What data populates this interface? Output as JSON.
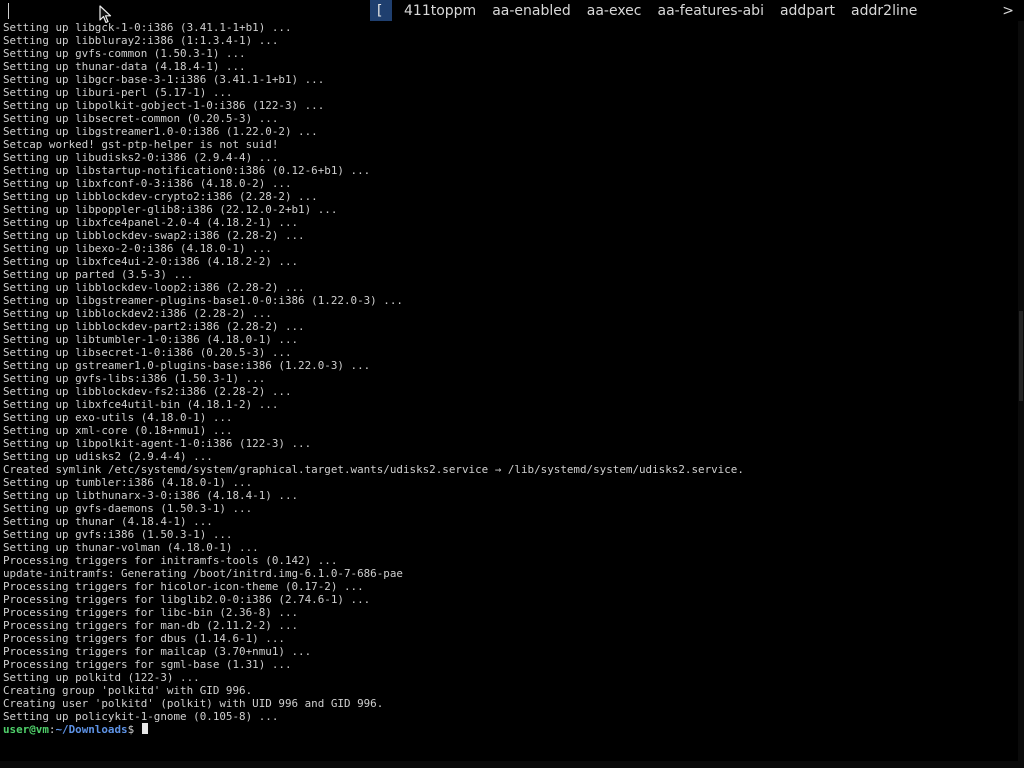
{
  "dmenu": {
    "prompt": "[",
    "items": [
      "411toppm",
      "aa-enabled",
      "aa-exec",
      "aa-features-abi",
      "addpart",
      "addr2line"
    ],
    "more_glyph": ">"
  },
  "terminal": {
    "lines": [
      "Setting up libgck-1-0:i386 (3.41.1-1+b1) ...",
      "Setting up libbluray2:i386 (1:1.3.4-1) ...",
      "Setting up gvfs-common (1.50.3-1) ...",
      "Setting up thunar-data (4.18.4-1) ...",
      "Setting up libgcr-base-3-1:i386 (3.41.1-1+b1) ...",
      "Setting up liburi-perl (5.17-1) ...",
      "Setting up libpolkit-gobject-1-0:i386 (122-3) ...",
      "Setting up libsecret-common (0.20.5-3) ...",
      "Setting up libgstreamer1.0-0:i386 (1.22.0-2) ...",
      "Setcap worked! gst-ptp-helper is not suid!",
      "Setting up libudisks2-0:i386 (2.9.4-4) ...",
      "Setting up libstartup-notification0:i386 (0.12-6+b1) ...",
      "Setting up libxfconf-0-3:i386 (4.18.0-2) ...",
      "Setting up libblockdev-crypto2:i386 (2.28-2) ...",
      "Setting up libpoppler-glib8:i386 (22.12.0-2+b1) ...",
      "Setting up libxfce4panel-2.0-4 (4.18.2-1) ...",
      "Setting up libblockdev-swap2:i386 (2.28-2) ...",
      "Setting up libexo-2-0:i386 (4.18.0-1) ...",
      "Setting up libxfce4ui-2-0:i386 (4.18.2-2) ...",
      "Setting up parted (3.5-3) ...",
      "Setting up libblockdev-loop2:i386 (2.28-2) ...",
      "Setting up libgstreamer-plugins-base1.0-0:i386 (1.22.0-3) ...",
      "Setting up libblockdev2:i386 (2.28-2) ...",
      "Setting up libblockdev-part2:i386 (2.28-2) ...",
      "Setting up libtumbler-1-0:i386 (4.18.0-1) ...",
      "Setting up libsecret-1-0:i386 (0.20.5-3) ...",
      "Setting up gstreamer1.0-plugins-base:i386 (1.22.0-3) ...",
      "Setting up gvfs-libs:i386 (1.50.3-1) ...",
      "Setting up libblockdev-fs2:i386 (2.28-2) ...",
      "Setting up libxfce4util-bin (4.18.1-2) ...",
      "Setting up exo-utils (4.18.0-1) ...",
      "Setting up xml-core (0.18+nmu1) ...",
      "Setting up libpolkit-agent-1-0:i386 (122-3) ...",
      "Setting up udisks2 (2.9.4-4) ...",
      "Created symlink /etc/systemd/system/graphical.target.wants/udisks2.service → /lib/systemd/system/udisks2.service.",
      "Setting up tumbler:i386 (4.18.0-1) ...",
      "Setting up libthunarx-3-0:i386 (4.18.4-1) ...",
      "Setting up gvfs-daemons (1.50.3-1) ...",
      "Setting up thunar (4.18.4-1) ...",
      "Setting up gvfs:i386 (1.50.3-1) ...",
      "Setting up thunar-volman (4.18.0-1) ...",
      "Processing triggers for initramfs-tools (0.142) ...",
      "update-initramfs: Generating /boot/initrd.img-6.1.0-7-686-pae",
      "Processing triggers for hicolor-icon-theme (0.17-2) ...",
      "Processing triggers for libglib2.0-0:i386 (2.74.6-1) ...",
      "Processing triggers for libc-bin (2.36-8) ...",
      "Processing triggers for man-db (2.11.2-2) ...",
      "Processing triggers for dbus (1.14.6-1) ...",
      "Processing triggers for mailcap (3.70+nmu1) ...",
      "Processing triggers for sgml-base (1.31) ...",
      "Setting up polkitd (122-3) ...",
      "Creating group 'polkitd' with GID 996.",
      "Creating user 'polkitd' (polkit) with UID 996 and GID 996.",
      "Setting up policykit-1-gnome (0.105-8) ..."
    ],
    "prompt": {
      "user_host": "user@vm",
      "separator": ":",
      "path": "~/Downloads",
      "symbol": "$ "
    }
  },
  "colors": {
    "background": "#000000",
    "text": "#cfcfcf",
    "prompt_user": "#4fd06a",
    "prompt_path": "#5e93e6",
    "dmenu_prompt_bg": "#1f3f6f"
  },
  "icons": {
    "pointer": "mouse-pointer-icon"
  }
}
